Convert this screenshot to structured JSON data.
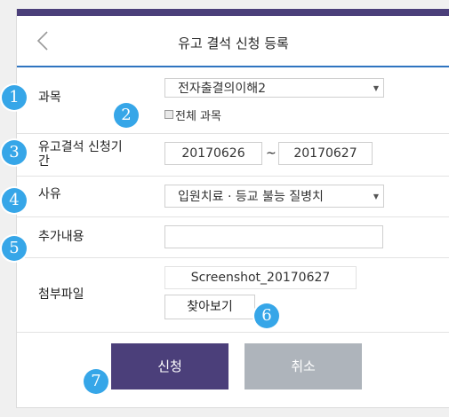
{
  "header": {
    "title": "유고 결석 신청 등록",
    "back_icon": "chevron-left-icon"
  },
  "form": {
    "course_label": "과목",
    "course_value": "전자출결의이해2",
    "all_courses_label": "전체 과목",
    "period_label_line1": "유고결석 신청기",
    "period_label_line2": "간",
    "period_start": "20170626",
    "period_separator": "~",
    "period_end": "20170627",
    "reason_label": "사유",
    "reason_value": "입원치료 · 등교 불능 질병치",
    "extra_label": "추가내용",
    "extra_value": "",
    "attach_label": "첨부파일",
    "attach_file": "Screenshot_20170627",
    "browse_label": "찾아보기"
  },
  "actions": {
    "submit_label": "신청",
    "cancel_label": "취소"
  },
  "badges": [
    "1",
    "2",
    "3",
    "4",
    "5",
    "6",
    "7"
  ],
  "colors": {
    "accent": "#4b3f7a",
    "header_line": "#2f74c0",
    "badge": "#36a6e8",
    "cancel": "#aeb4bb"
  }
}
